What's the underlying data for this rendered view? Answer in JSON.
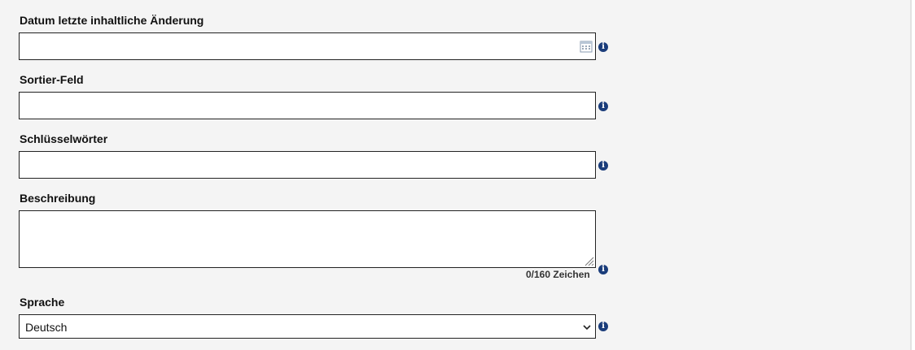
{
  "fields": {
    "datum": {
      "label": "Datum letzte inhaltliche Änderung",
      "value": ""
    },
    "sortier": {
      "label": "Sortier-Feld",
      "value": ""
    },
    "schluessel": {
      "label": "Schlüsselwörter",
      "value": ""
    },
    "beschreibung": {
      "label": "Beschreibung",
      "value": "",
      "counter": "0/160 Zeichen"
    },
    "sprache": {
      "label": "Sprache",
      "selected": "Deutsch"
    }
  },
  "icons": {
    "info": "info-icon",
    "calendar": "calendar-icon",
    "dropdown": "chevron-down-icon"
  },
  "colors": {
    "info_icon": "#1a3c7a",
    "panel_bg": "#f4f4f4"
  }
}
